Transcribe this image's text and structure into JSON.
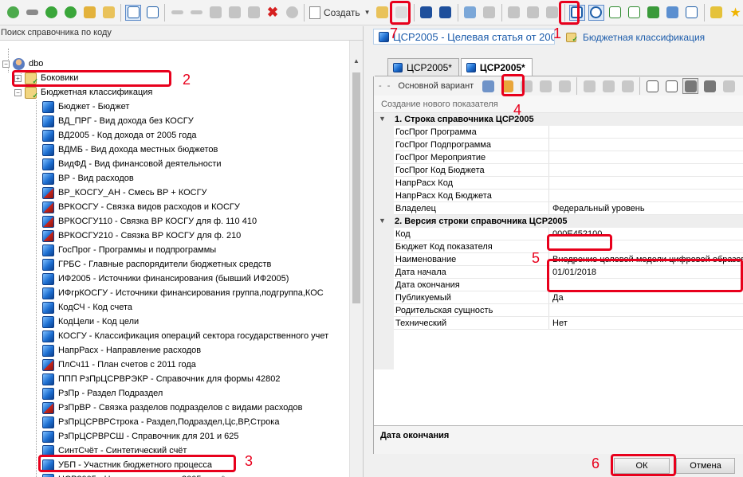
{
  "toolbar": {
    "create_label": "Создать",
    "annotations": {
      "save": "7",
      "props": "1"
    }
  },
  "left": {
    "search_placeholder": "Поиск справочника по коду",
    "root_label": "dbo",
    "tree_items": [
      {
        "label": "Боковики",
        "type": "folder"
      },
      {
        "label": "Бюджетная классификация",
        "type": "folder"
      },
      {
        "label": "Бюджет - Бюджет",
        "type": "cube"
      },
      {
        "label": "ВД_ПРГ - Вид дохода без КОСГУ",
        "type": "cube"
      },
      {
        "label": "ВД2005 - Код дохода от 2005 года",
        "type": "cube"
      },
      {
        "label": "ВДМБ - Вид дохода местных бюджетов",
        "type": "cube"
      },
      {
        "label": "ВидФД - Вид финансовой деятельности",
        "type": "cube"
      },
      {
        "label": "ВР - Вид расходов",
        "type": "cube"
      },
      {
        "label": "ВР_КОСГУ_АН - Смесь ВР + КОСГУ",
        "type": "cube-red"
      },
      {
        "label": "ВРКОСГУ - Связка видов расходов и КОСГУ",
        "type": "cube-red"
      },
      {
        "label": "ВРКОСГУ110 - Связка ВР КОСГУ для ф. 110 410",
        "type": "cube-red"
      },
      {
        "label": "ВРКОСГУ210 - Связка ВР КОСГУ для ф. 210",
        "type": "cube-red"
      },
      {
        "label": "ГосПрог - Программы и подпрограммы",
        "type": "cube"
      },
      {
        "label": "ГРБС - Главные распорядители бюджетных средств",
        "type": "cube"
      },
      {
        "label": "ИФ2005 - Источники финансирования (бывший ИФ2005)",
        "type": "cube"
      },
      {
        "label": "ИФгрКОСГУ - Источники финансирования группа,подгруппа,КОС",
        "type": "cube"
      },
      {
        "label": "КодСЧ - Код счета",
        "type": "cube"
      },
      {
        "label": "КодЦели - Код цели",
        "type": "cube"
      },
      {
        "label": "КОСГУ - Классификация  операций сектора государственного учет",
        "type": "cube"
      },
      {
        "label": "НапрРасх - Направление расходов",
        "type": "cube"
      },
      {
        "label": "ПлСч11 - План счетов с 2011 года",
        "type": "cube-red"
      },
      {
        "label": "ППП РзПрЦСРВРЭКР - Справочник для формы 42802",
        "type": "cube"
      },
      {
        "label": "РзПр - Раздел Подраздел",
        "type": "cube"
      },
      {
        "label": "РзПрВР - Связка разделов подразделов с видами расходов",
        "type": "cube-red"
      },
      {
        "label": "РзПрЦСРВРСтрока - Раздел,Подраздел,Цс,ВР,Строка",
        "type": "cube"
      },
      {
        "label": "РзПрЦСРВРСШ - Справочник для 201 и 625",
        "type": "cube"
      },
      {
        "label": "СинтСчёт - Синтетический счёт",
        "type": "cube"
      },
      {
        "label": "УБП - Участник бюджетного процесса",
        "type": "cube"
      },
      {
        "label": "ЦСР2005 - Целевая статья от 2005 года*",
        "type": "cube"
      }
    ],
    "annotations": {
      "budget": "2",
      "csr": "3"
    }
  },
  "right": {
    "doc_tab_label": "ЦСР2005 - Целевая статья от 2005",
    "budget_link": "Бюджетная классификация",
    "inner_tabs": [
      "ЦСР2005*",
      "ЦСР2005*"
    ],
    "variant_label": "Основной вариант",
    "create_indicator": "Создание нового показателя",
    "annotations": {
      "create": "4",
      "fields": "5",
      "ok": "6"
    },
    "section1_title": "1. Строка справочника ЦСР2005",
    "section1_rows": [
      {
        "k": "ГосПрог Программа",
        "v": ""
      },
      {
        "k": "ГосПрог Подпрограмма",
        "v": ""
      },
      {
        "k": "ГосПрог Мероприятие",
        "v": ""
      },
      {
        "k": "ГосПрог Код Бюджета",
        "v": ""
      },
      {
        "k": "НапрРасх Код",
        "v": ""
      },
      {
        "k": "НапрРасх Код Бюджета",
        "v": ""
      },
      {
        "k": "Владелец",
        "v": "Федеральный уровень"
      }
    ],
    "section2_title": "2. Версия строки справочника ЦСР2005",
    "section2_rows": [
      {
        "k": "Код",
        "v": "000E452100"
      },
      {
        "k": "Бюджет Код показателя",
        "v": ""
      },
      {
        "k": "Наименование",
        "v": "Внедрение целевой модели цифровой образов"
      },
      {
        "k": "Дата начала",
        "v": "01/01/2018"
      },
      {
        "k": "Дата окончания",
        "v": ""
      },
      {
        "k": "Публикуемый",
        "v": "Да"
      },
      {
        "k": "Родительская сущность",
        "v": ""
      },
      {
        "k": "Технический",
        "v": "Нет"
      }
    ],
    "description_title": "Дата окончания",
    "ok_label": "ОК",
    "cancel_label": "Отмена"
  }
}
